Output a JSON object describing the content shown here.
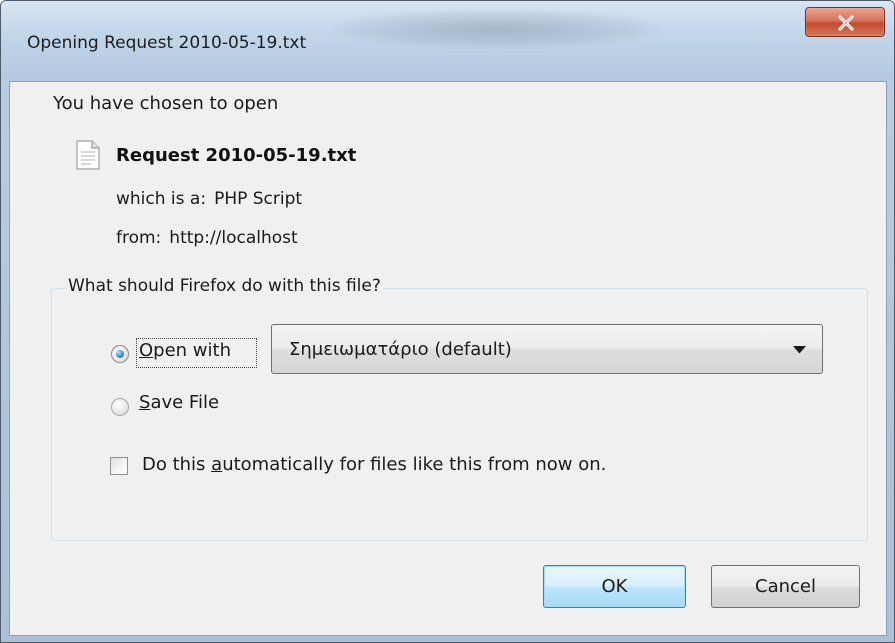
{
  "window": {
    "title": "Opening Request 2010-05-19.txt"
  },
  "icons": {
    "close": "close-icon",
    "file": "text-file-icon",
    "dropdown": "chevron-down-icon"
  },
  "dialog": {
    "intro": "You have chosen to open",
    "file_name": "Request 2010-05-19.txt",
    "type_label": "which is a:",
    "type_value": "PHP Script",
    "from_label": "from:",
    "from_value": "http://localhost"
  },
  "action_group": {
    "legend": "What should Firefox do with this file?",
    "open_with": {
      "mnemonic": "O",
      "rest": "pen with",
      "selected": true
    },
    "application": "Σημειωματάριο (default)",
    "save_file": {
      "mnemonic": "S",
      "rest": "ave File",
      "selected": false
    },
    "auto": {
      "before": "Do this ",
      "mnemonic": "a",
      "after": "utomatically for files like this from now on.",
      "checked": false
    }
  },
  "buttons": {
    "ok": "OK",
    "cancel": "Cancel"
  },
  "colors": {
    "accent": "#3a8fd6",
    "close_button": "#c24a2f",
    "default_button_border": "#3c7fb1"
  }
}
